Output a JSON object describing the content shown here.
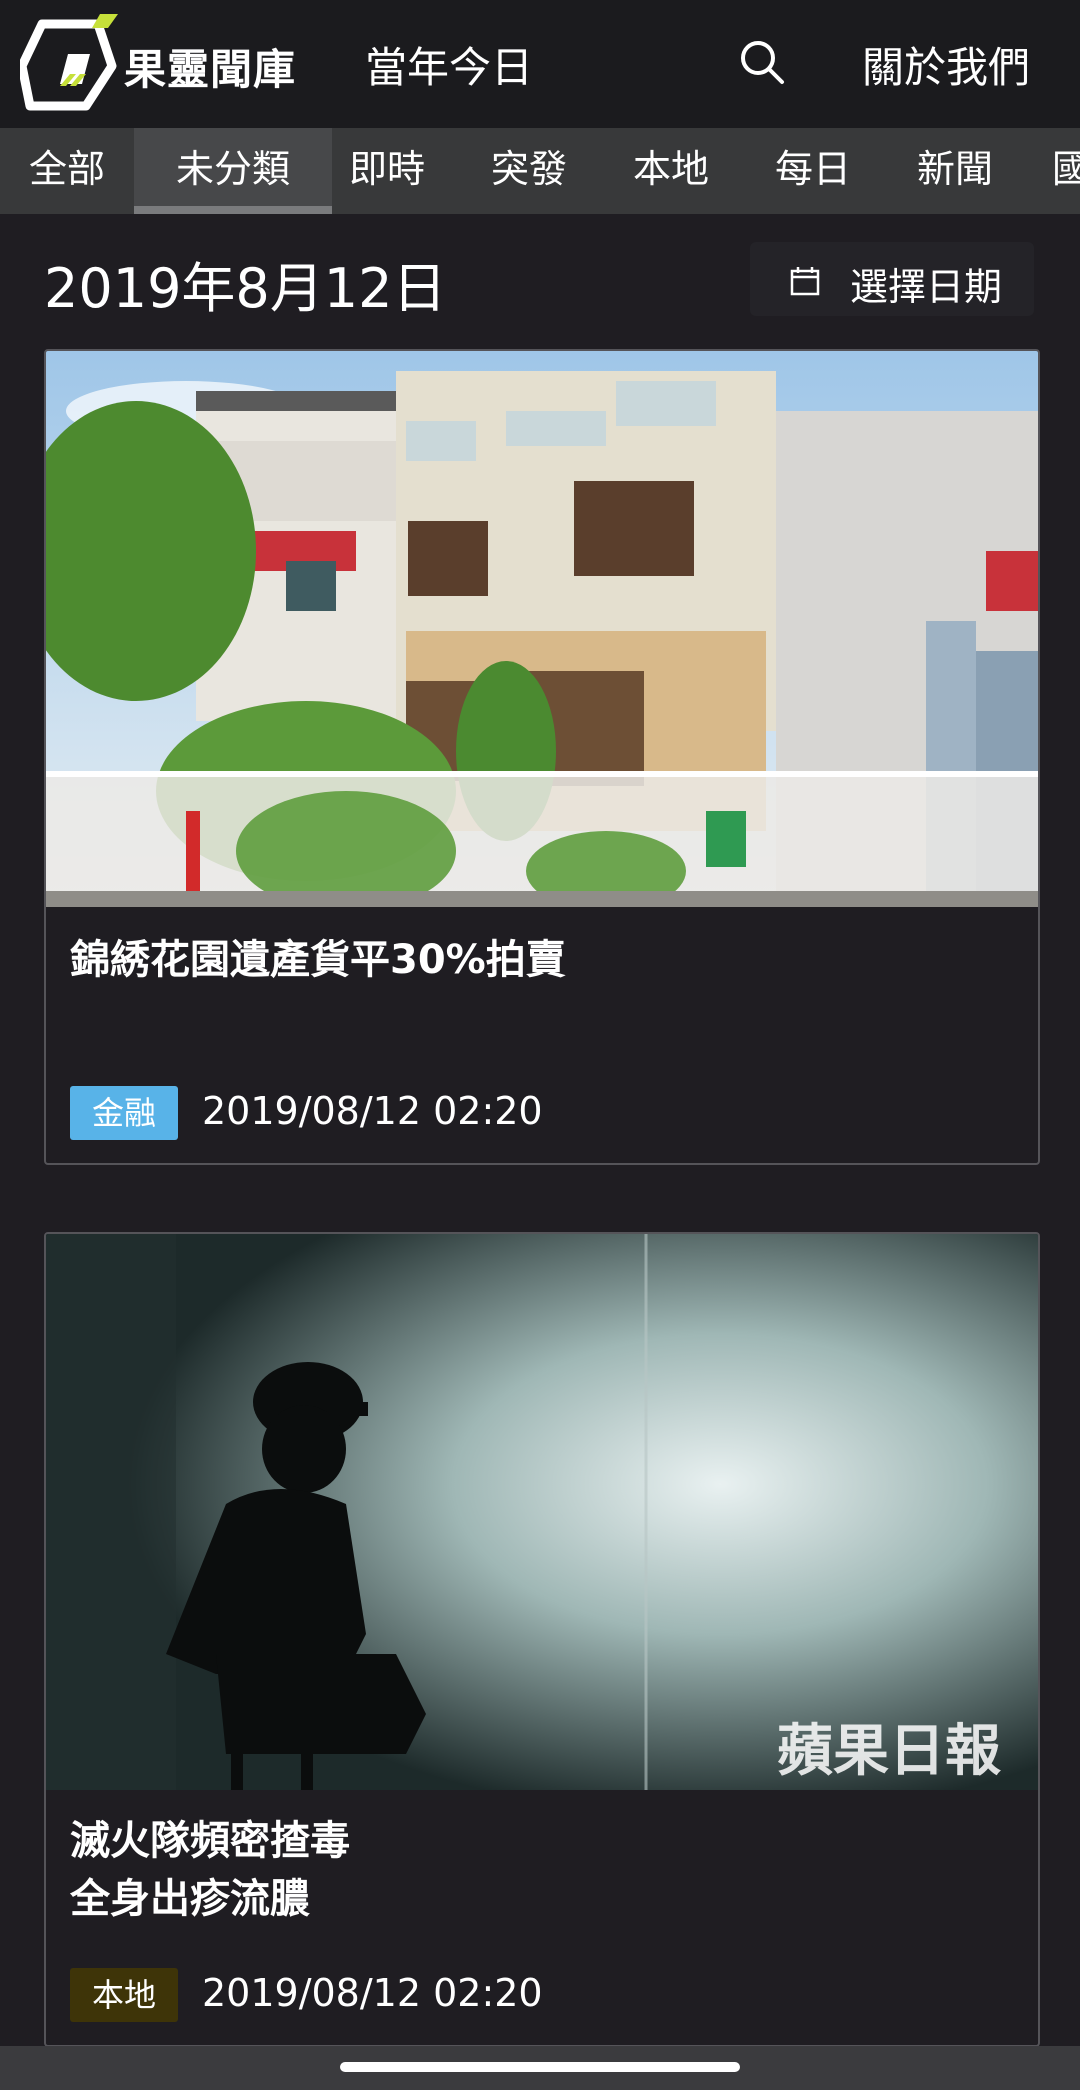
{
  "header": {
    "brand": "果靈聞庫",
    "nav_today": "當年今日",
    "nav_about": "關於我們"
  },
  "tabs": [
    {
      "label": "全部"
    },
    {
      "label": "未分類"
    },
    {
      "label": "即時"
    },
    {
      "label": "突發"
    },
    {
      "label": "本地"
    },
    {
      "label": "每日"
    },
    {
      "label": "新聞"
    },
    {
      "label": "國"
    }
  ],
  "active_tab": "未分類",
  "date_title": "2019年8月12日",
  "date_picker_label": "選擇日期",
  "articles": [
    {
      "title": "錦綉花園遺產貨平30%拍賣",
      "tag": "金融",
      "tag_color": "#58b3e8",
      "timestamp": "2019/08/12 02:20"
    },
    {
      "title_line1": "滅火隊頻密揸毒",
      "title_line2": "全身出疹流膿",
      "tag": "本地",
      "tag_color": "#3e3408",
      "timestamp": "2019/08/12 02:20",
      "watermark": "蘋果日報"
    }
  ],
  "colors": {
    "background": "#1f1d22",
    "header": "#1b1b1e",
    "tabs_bar": "#38393a",
    "logo_accent": "#c6e03a"
  }
}
